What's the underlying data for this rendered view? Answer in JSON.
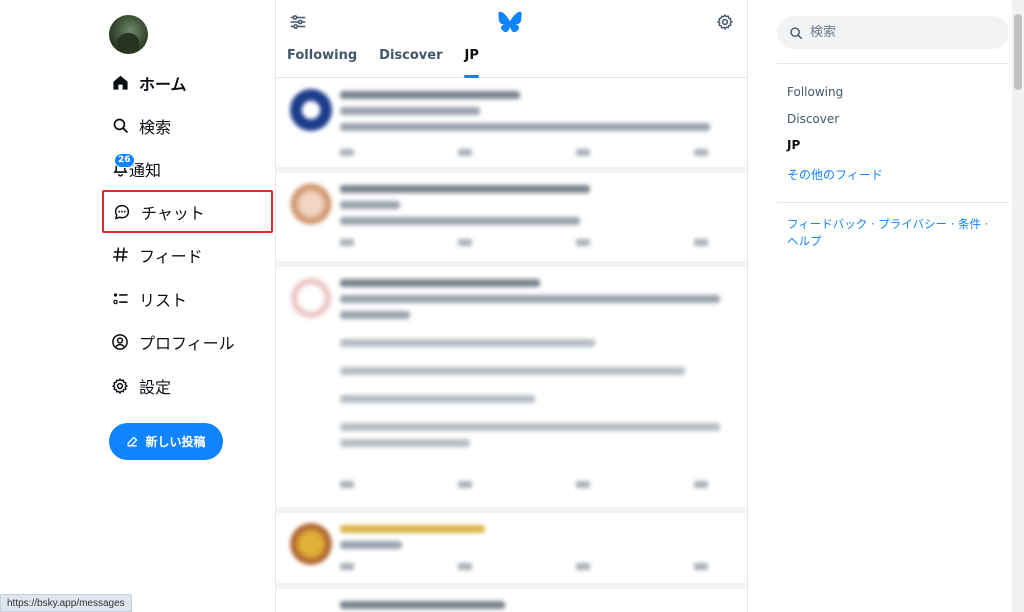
{
  "nav": {
    "items": [
      {
        "label": "ホーム",
        "icon": "home-icon"
      },
      {
        "label": "検索",
        "icon": "search-icon"
      },
      {
        "label": "通知",
        "icon": "bell-icon",
        "badge": "26"
      },
      {
        "label": "チャット",
        "icon": "chat-icon"
      },
      {
        "label": "フィード",
        "icon": "hash-icon"
      },
      {
        "label": "リスト",
        "icon": "list-icon"
      },
      {
        "label": "プロフィール",
        "icon": "profile-icon"
      },
      {
        "label": "設定",
        "icon": "gear-icon"
      }
    ],
    "new_post_label": "新しい投稿"
  },
  "feed": {
    "tabs": [
      "Following",
      "Discover",
      "JP"
    ],
    "active_tab": "JP"
  },
  "sidebar": {
    "search_placeholder": "検索",
    "feeds": [
      "Following",
      "Discover",
      "JP"
    ],
    "more_feeds": "その他のフィード",
    "footer": {
      "feedback": "フィードバック",
      "privacy": "プライバシー",
      "terms": "条件",
      "help": "ヘルプ",
      "separator": "·"
    }
  },
  "statusbar": {
    "url": "https://bsky.app/messages"
  },
  "colors": {
    "accent": "#1083fe",
    "highlight_border": "#d62d2d",
    "text": "#0b0f14",
    "muted": "#42576c"
  }
}
